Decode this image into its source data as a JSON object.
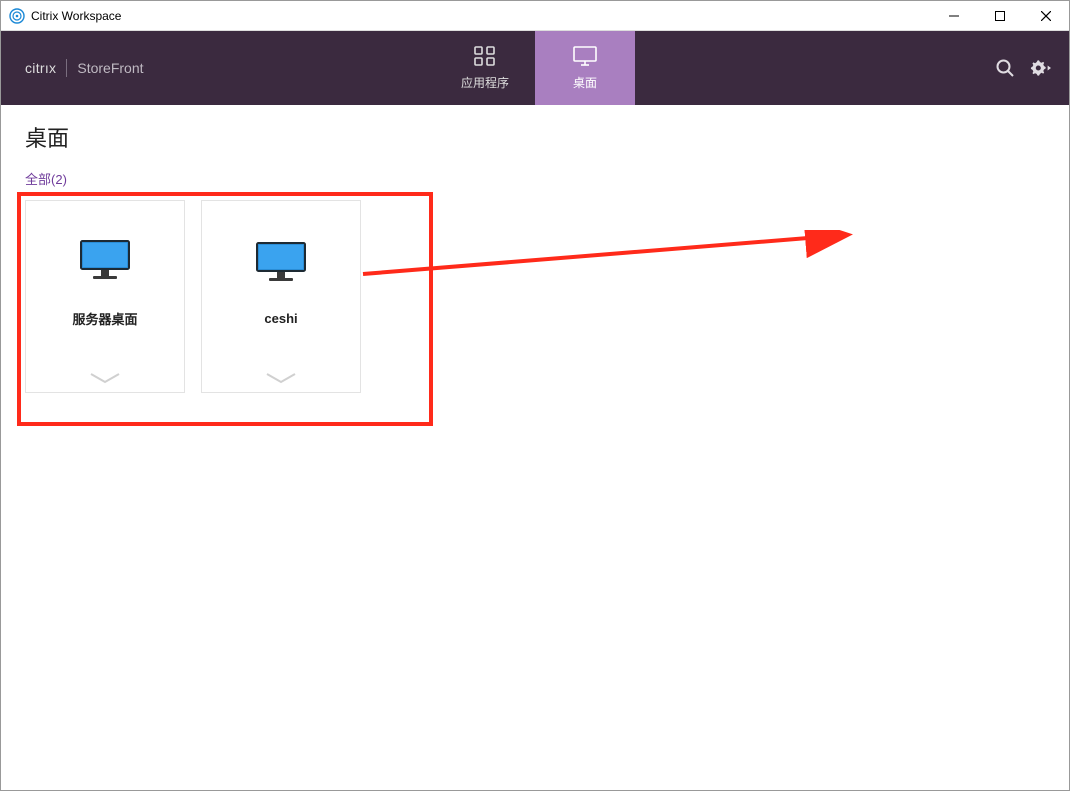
{
  "window": {
    "title": "Citrix Workspace"
  },
  "brand": {
    "citrix": "citrıx",
    "storefront": "StoreFront"
  },
  "tabs": {
    "apps": "应用程序",
    "desktops": "桌面"
  },
  "page": {
    "title": "桌面"
  },
  "filter": {
    "all_label": "全部",
    "count": "2"
  },
  "desktops": [
    {
      "label": "服务器桌面"
    },
    {
      "label": "ceshi"
    }
  ]
}
